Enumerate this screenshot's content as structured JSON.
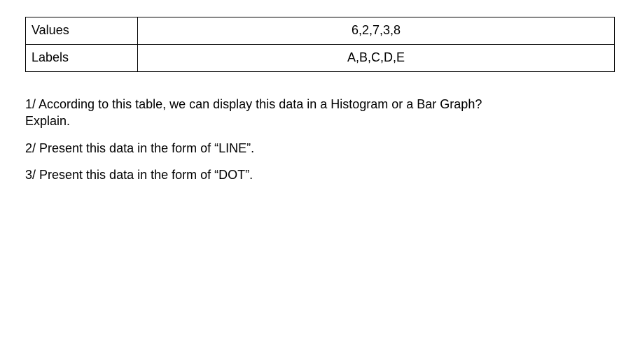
{
  "table": {
    "rows": [
      {
        "label": "Values",
        "value": "6,2,7,3,8"
      },
      {
        "label": "Labels",
        "value": "A,B,C,D,E"
      }
    ]
  },
  "questions": {
    "q1_line1": "1/ According to this table, we can display this data in a Histogram or a Bar Graph?",
    "q1_line2": "Explain.",
    "q2": "2/ Present this data in the form of “LINE”.",
    "q3": "3/ Present this data in the form of “DOT”."
  },
  "chart_data": {
    "type": "table",
    "categories": [
      "A",
      "B",
      "C",
      "D",
      "E"
    ],
    "values": [
      6,
      2,
      7,
      3,
      8
    ],
    "title": "",
    "xlabel": "Labels",
    "ylabel": "Values"
  }
}
